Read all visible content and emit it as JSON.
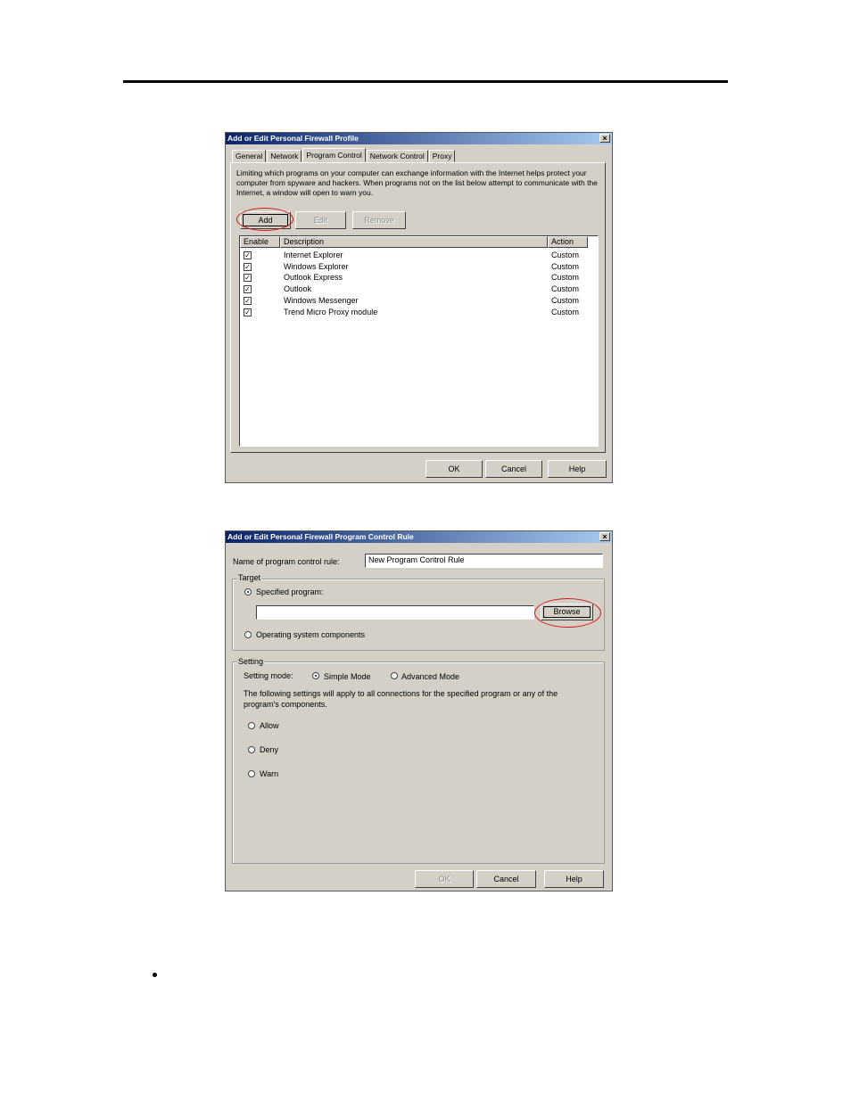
{
  "profile_dialog": {
    "title": "Add or Edit Personal Firewall Profile",
    "close_glyph": "×",
    "tabs": [
      "General",
      "Network",
      "Program Control",
      "Network Control",
      "Proxy"
    ],
    "active_tab": "Program Control",
    "description": "Limiting which programs on your computer can exchange information with the Internet helps protect your computer from spyware and hackers. When programs not on the list below attempt to communicate with the Internet, a window will open to warn you.",
    "add_label": "Add",
    "edit_label": "Edit",
    "remove_label": "Remove",
    "columns": [
      "Enable",
      "Description",
      "Action"
    ],
    "rows": [
      {
        "enabled": true,
        "description": "Internet Explorer",
        "action": "Custom"
      },
      {
        "enabled": true,
        "description": "Windows Explorer",
        "action": "Custom"
      },
      {
        "enabled": true,
        "description": "Outlook Express",
        "action": "Custom"
      },
      {
        "enabled": true,
        "description": "Outlook",
        "action": "Custom"
      },
      {
        "enabled": true,
        "description": "Windows Messenger",
        "action": "Custom"
      },
      {
        "enabled": true,
        "description": "Trend Micro Proxy module",
        "action": "Custom"
      }
    ],
    "ok_label": "OK",
    "cancel_label": "Cancel",
    "help_label": "Help"
  },
  "rule_dialog": {
    "title": "Add or Edit Personal Firewall Program Control Rule",
    "close_glyph": "×",
    "name_label": "Name of program control rule:",
    "name_value": "New Program Control Rule",
    "target_group": "Target",
    "specified_program_label": "Specified program:",
    "program_path_value": "",
    "browse_label": "Browse",
    "os_components_label": "Operating system components",
    "target_selected": "specified",
    "setting_group": "Setting",
    "setting_mode_label": "Setting mode:",
    "simple_mode_label": "Simple Mode",
    "advanced_mode_label": "Advanced Mode",
    "mode_selected": "simple",
    "setting_note": "The following settings will apply to all connections for the specified program or any of the program's components.",
    "allow_label": "Allow",
    "deny_label": "Deny",
    "warn_label": "Warn",
    "ok_label": "OK",
    "cancel_label": "Cancel",
    "help_label": "Help"
  },
  "colors": {
    "dialog_face": "#d4d0c8",
    "titlebar_start": "#0a246a",
    "titlebar_end": "#a6caf0",
    "highlight_ring": "#d01818"
  }
}
